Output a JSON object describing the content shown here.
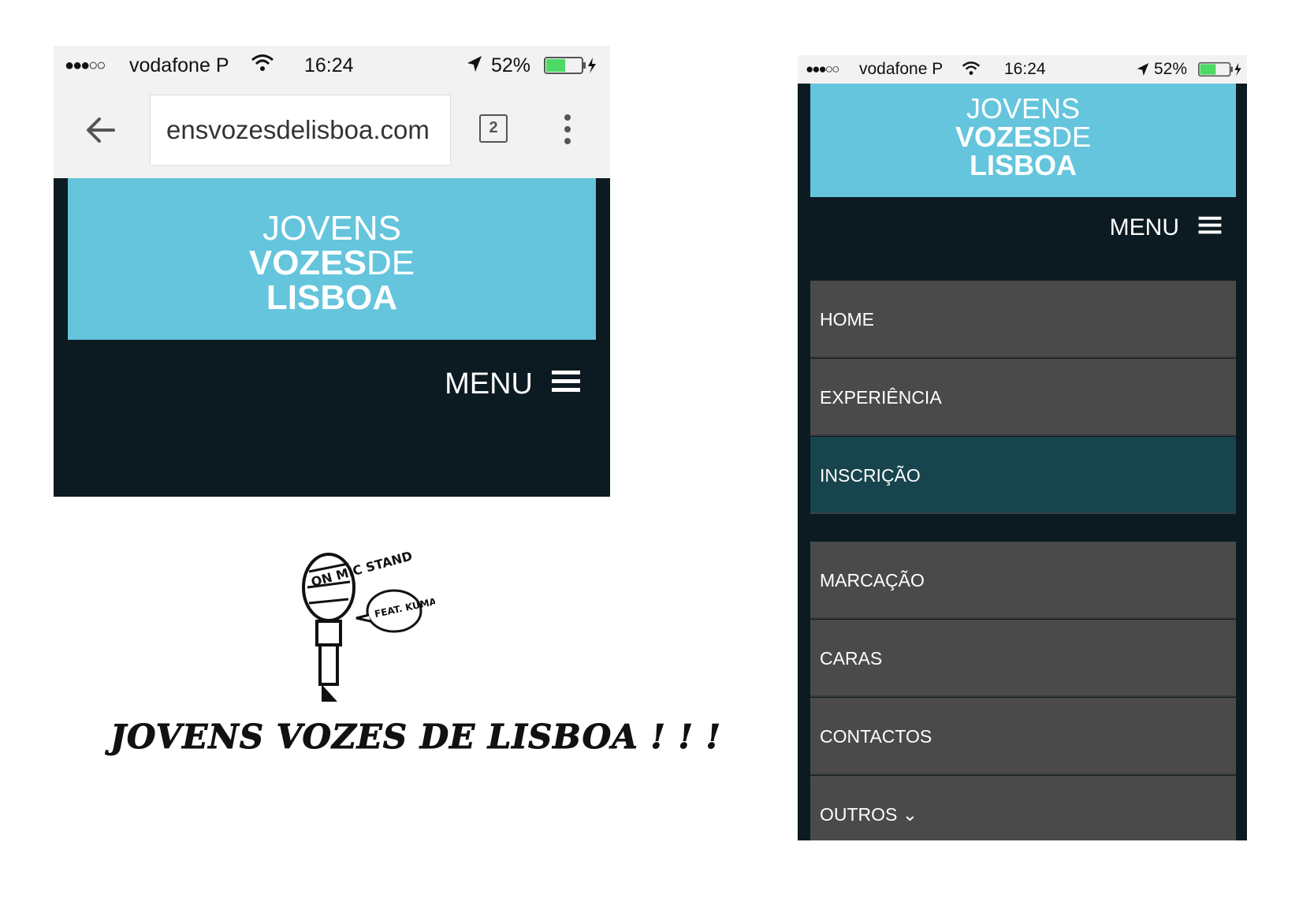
{
  "left_phone": {
    "status_bar": {
      "signal": "●●●○○",
      "carrier": "vodafone P",
      "time": "16:24",
      "battery": "52%"
    },
    "browser": {
      "url": "ensvozesdelisboa.com",
      "tab_count": "2"
    },
    "banner": {
      "line1": "JOVENS",
      "line2_bold": "VOZES",
      "line2_light": "DE",
      "line3": "LISBOA"
    },
    "menu_label": "MENU",
    "illustration": {
      "title": "JOVENS  VOZES  DE LISBOA ! ! !",
      "mic_text": "ON MIC STAND",
      "bubble_text": "FEAT. KUMAR"
    }
  },
  "right_phone": {
    "status_bar": {
      "signal": "●●●○○",
      "carrier": "vodafone P",
      "time": "16:24",
      "battery": "52%"
    },
    "banner": {
      "line1": "JOVENS",
      "line2_bold": "VOZES",
      "line2_light": "DE",
      "line3": "LISBOA"
    },
    "menu_label": "MENU",
    "nav": {
      "home": "HOME",
      "experiencia": "EXPERIÊNCIA",
      "inscricao": "INSCRIÇÃO",
      "marcacao": "MARCAÇÃO",
      "caras": "CARAS",
      "contactos": "CONTACTOS",
      "outros": "OUTROS ⌄"
    }
  },
  "colors": {
    "banner": "#64c5dd",
    "page_dark": "#0c1b21",
    "nav_item": "#4a4a4a",
    "nav_active": "#17444d"
  }
}
